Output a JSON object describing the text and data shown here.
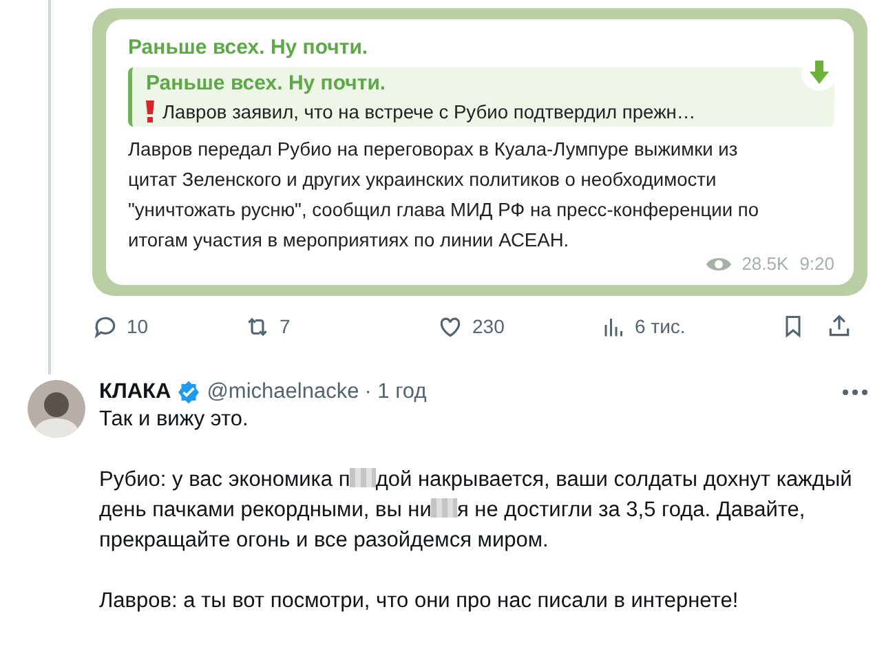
{
  "post_card": {
    "channel_title": "Раньше всех. Ну почти.",
    "quote": {
      "title": "Раньше всех. Ну почти.",
      "text": "Лавров заявил, что на встрече с Рубио подтвердил прежн…"
    },
    "body": "Лавров передал Рубио на переговорах в Куала-Лумпуре выжимки из цитат Зеленского и других украинских политиков о необходимости \"уничтожать русню\", сообщил глава МИД РФ на пресс-конференции по итогам участия в мероприятиях по линии АСЕАН.",
    "views": "28.5K",
    "time": "9:20"
  },
  "actions": [
    {
      "kind": "reply",
      "count": "10"
    },
    {
      "kind": "repost",
      "count": "7"
    },
    {
      "kind": "like",
      "count": "230"
    },
    {
      "kind": "views",
      "count": "6 тис."
    },
    {
      "kind": "bookmark"
    },
    {
      "kind": "share"
    }
  ],
  "reply": {
    "name": "КЛАКА",
    "verified": true,
    "handle": "@michaelnacke",
    "time": "· 1 год",
    "paragraphs": [
      [
        {
          "kind": "text",
          "text": "Так и вижу это."
        }
      ],
      [
        {
          "kind": "text",
          "text": "Рубио: у вас экономика п"
        },
        {
          "kind": "censored"
        },
        {
          "kind": "text",
          "text": "дой накрывается, ваши солдаты дохнут каждый день пачками рекордными, вы ни"
        },
        {
          "kind": "censored"
        },
        {
          "kind": "text",
          "text": "я не достигли за 3,5 года. Давайте, прекращайте огонь и все разойдемся миром."
        }
      ],
      [
        {
          "kind": "text",
          "text": "Лавров: а ты вот посмотри, что они про нас писали в интернете!"
        }
      ]
    ]
  }
}
